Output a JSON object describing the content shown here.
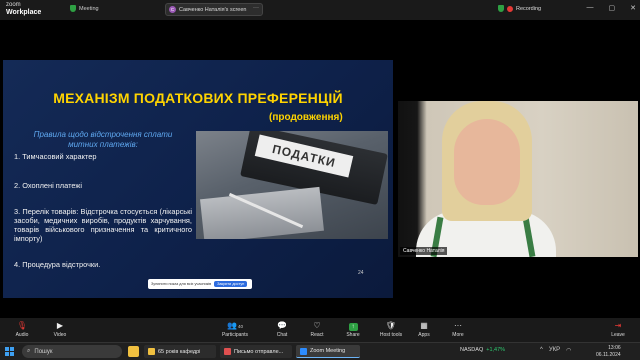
{
  "topbar": {
    "brand_line1": "zoom",
    "brand_line2": "Workplace",
    "meeting_label": "Meeting",
    "share_avatar": "C",
    "share_label": "Савченко Наталія's screen",
    "share_more": "···",
    "recording": "Recording",
    "win_minimize": "—",
    "win_maximize": "▢",
    "win_close": "✕"
  },
  "slide": {
    "title": "МЕХАНІЗМ ПОДАТКОВИХ ПРЕФЕРЕНЦІЙ",
    "subtitle": "(продовження)",
    "rules_heading": "Правила щодо відстрочення сплати митних платежів:",
    "item1": "1. Тимчасовий характер",
    "item2": "2. Охоплені платежі",
    "item3": "3. Перелік товарів: Відстрочка стосується (лікарські засоби, медичних виробів, продуктів харчування, товарів військового призначення та критичного імпорту)",
    "item4": "4. Процедура відстрочки.",
    "photo_label": "ПОДАТКИ",
    "page_number": "24",
    "control_label": "Зупинити показ для всіх учасників",
    "control_button": "Закрити доступ"
  },
  "camera": {
    "participant_name": "Савченко Наталія"
  },
  "toolbar": {
    "audio": "Audio",
    "video": "Video",
    "participants": "Participants",
    "participants_count": "40",
    "chat": "Chat",
    "react": "React",
    "share": "Share",
    "host_tools": "Host tools",
    "apps": "Apps",
    "more": "More",
    "leave": "Leave"
  },
  "taskbar": {
    "search_placeholder": "Пошук",
    "task1": "65 років кафедрі",
    "task2": "Письмо отправле...",
    "task3": "Zoom Meeting",
    "stock_name": "NASDAQ",
    "stock_change": "+1,47%",
    "lang": "УКР",
    "time": "13:06",
    "date": "06.11.2024"
  },
  "colors": {
    "slide_bg": "#142a56",
    "title_yellow": "#ffd400",
    "rules_blue": "#5fa8f0",
    "recording_red": "#e53935",
    "share_green": "#2ea043"
  }
}
